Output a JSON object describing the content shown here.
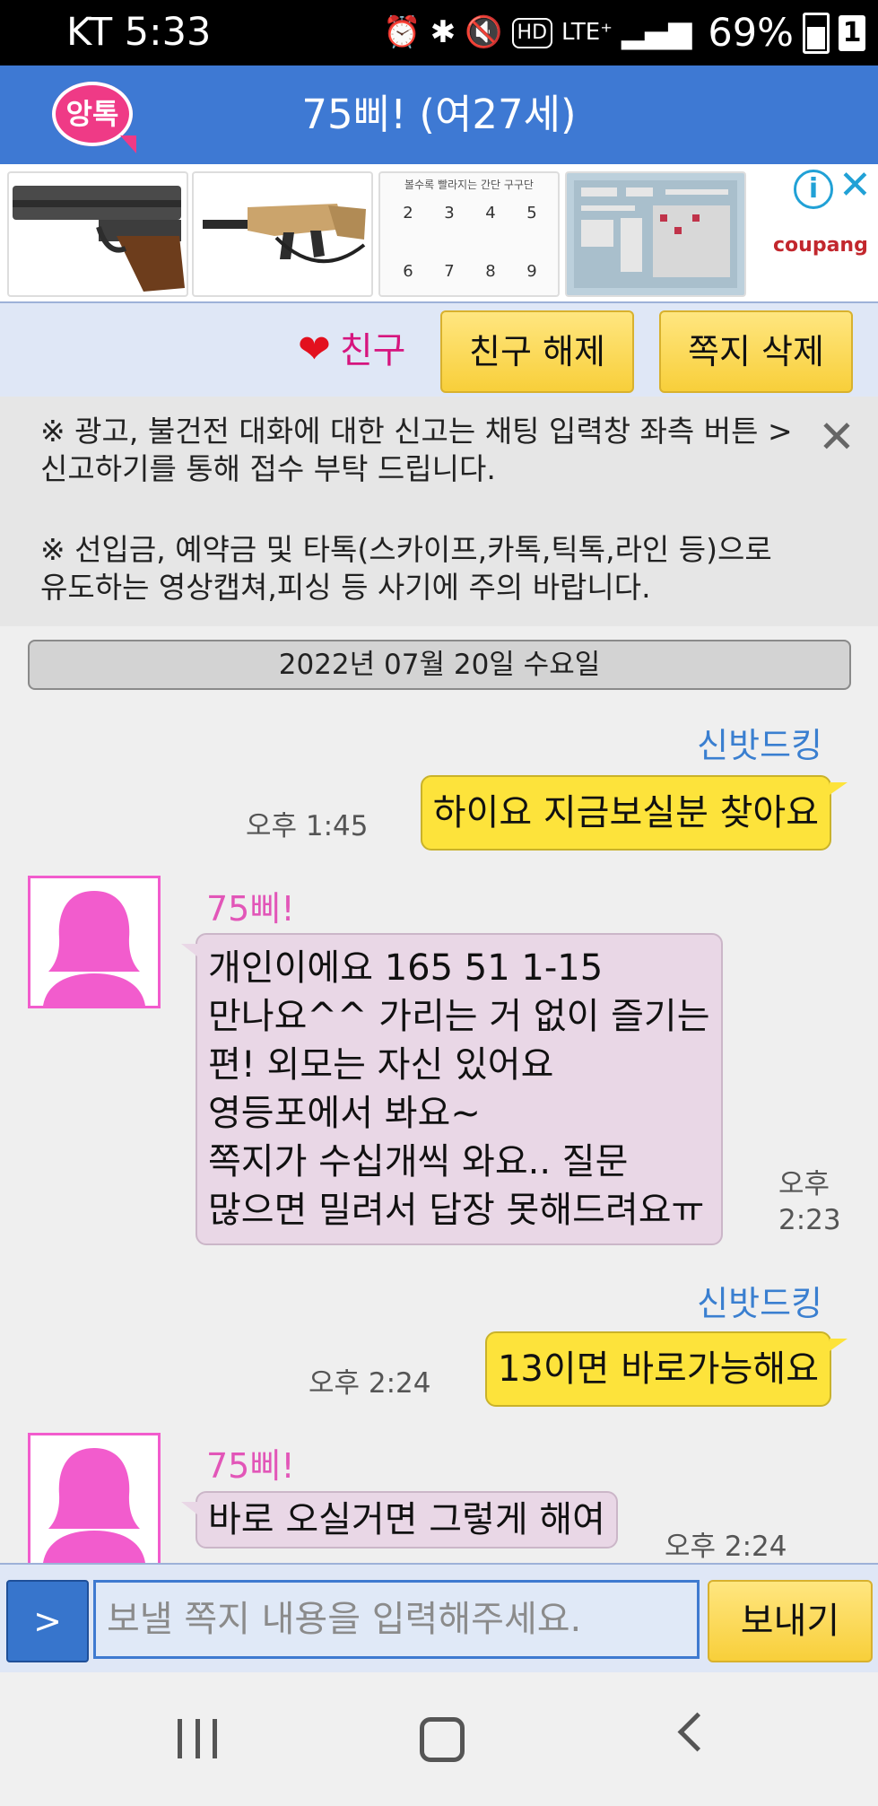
{
  "status_bar": {
    "carrier_time": "KT 5:33",
    "indicators": [
      "alarm-icon",
      "bluetooth-icon",
      "mute-icon",
      "hd-voice-icon",
      "lte-plus-icon",
      "signal-icon"
    ],
    "battery": "69%",
    "sim_number": "1"
  },
  "header": {
    "logo_text": "앙톡",
    "title": "75삐! (여27세)"
  },
  "ad": {
    "thumbnails": [
      "pistol-product-image",
      "rifle-product-image",
      "multiplication-chart-product-image",
      "decal-sheet-product-image"
    ],
    "chart_heading": "볼수록 빨라지는 간단 구구단",
    "chart_numbers": [
      "2",
      "3",
      "4",
      "5",
      "6",
      "7",
      "8",
      "9"
    ],
    "brand": "coupang"
  },
  "friend_bar": {
    "friend_label": "친구",
    "unfriend_button": "친구 해제",
    "delete_button": "쪽지 삭제"
  },
  "notice": {
    "line1": "※ 광고, 불건전 대화에 대한 신고는 채팅 입력창 좌측 버튼 > 신고하기를 통해 접수 부탁 드립니다.",
    "line2": "※ 선입금, 예약금 및 타톡(스카이프,카톡,틱톡,라인 등)으로 유도하는 영상캡쳐,피싱 등 사기에 주의 바랍니다."
  },
  "chat": {
    "date": "2022년 07월 20일 수요일",
    "messages": [
      {
        "from": "me",
        "sender": "신밧드킹",
        "text": "하이요 지금보실분 찾아요",
        "time": "오후 1:45"
      },
      {
        "from": "her",
        "sender": "75삐!",
        "lines": [
          "개인이에요 165 51 1-15",
          "만나요^^ 가리는 거 없이 즐기는",
          "편! 외모는 자신 있어요",
          "영등포에서 봐요~",
          "쪽지가 수십개씩 와요.. 질문",
          "많으면 밀려서 답장 못해드려요ㅠ"
        ],
        "time_top": "오후",
        "time_bottom": "2:23"
      },
      {
        "from": "me",
        "sender": "신밧드킹",
        "text": "13이면 바로가능해요",
        "time": "오후 2:24"
      },
      {
        "from": "her",
        "sender": "75삐!",
        "text": "바로 오실거면 그렇게 해여",
        "time": "오후 2:24"
      }
    ]
  },
  "input_bar": {
    "menu_button": ">",
    "placeholder": "보낼 쪽지 내용을 입력해주세요.",
    "send_button": "보내기"
  },
  "colors": {
    "header_blue": "#3e79d3",
    "my_bubble": "#fde33b",
    "her_bubble": "#e9d7e6",
    "her_name": "#e256b8",
    "my_name": "#3a7fd0"
  }
}
